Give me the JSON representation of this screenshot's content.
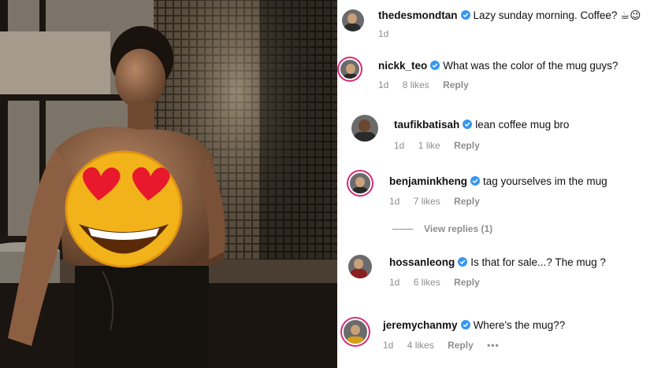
{
  "comments": [
    {
      "username": "thedesmondtan",
      "text": "Lazy sunday morning. Coffee? ☕😉",
      "time": "1d",
      "likes": "",
      "reply_label": ""
    },
    {
      "username": "nickk_teo",
      "text": "What was the color of the mug guys?",
      "time": "1d",
      "likes": "8 likes",
      "reply_label": "Reply"
    },
    {
      "username": "taufikbatisah",
      "text": "lean coffee mug bro",
      "time": "1d",
      "likes": "1 like",
      "reply_label": "Reply"
    },
    {
      "username": "benjaminkheng",
      "text": "tag yourselves im the mug",
      "time": "1d",
      "likes": "7 likes",
      "reply_label": "Reply"
    },
    {
      "username": "hossanleong",
      "text": "Is that for sale...? The mug ?",
      "time": "1d",
      "likes": "6 likes",
      "reply_label": "Reply"
    },
    {
      "username": "jeremychanmy",
      "text": "Where's the mug??",
      "time": "1d",
      "likes": "4 likes",
      "reply_label": "Reply"
    }
  ],
  "view_replies": "View replies (1)",
  "more_options": "•••",
  "colors": {
    "verified": "#3897f0",
    "meta": "#8e8e8e",
    "story_ring": "#d62976"
  },
  "photo": {
    "sticker_icon": "heart-eyes-emoji-icon"
  }
}
